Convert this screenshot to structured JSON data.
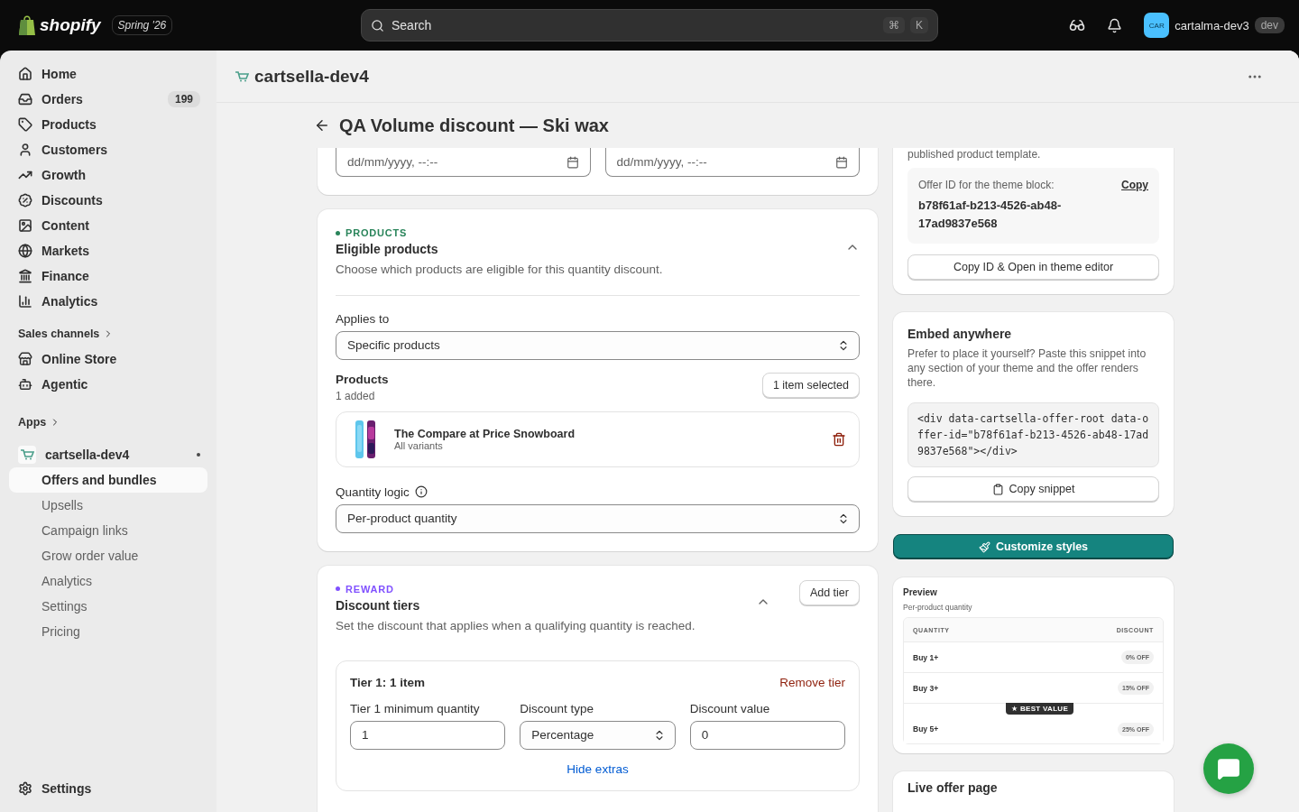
{
  "topbar": {
    "logo": "shopify",
    "edition": "Spring '26",
    "search": {
      "placeholder": "Search",
      "keys": [
        "⌘",
        "K"
      ]
    },
    "avatar": "CAR",
    "store": "cartalma-dev3",
    "tag": "dev"
  },
  "sidebar": {
    "items": [
      {
        "label": "Home",
        "selected": false
      },
      {
        "label": "Orders",
        "badge": "199",
        "selected": false
      },
      {
        "label": "Products",
        "selected": false
      },
      {
        "label": "Customers",
        "selected": false
      },
      {
        "label": "Growth",
        "selected": false
      },
      {
        "label": "Discounts",
        "selected": false
      },
      {
        "label": "Content",
        "selected": false
      },
      {
        "label": "Markets",
        "selected": false
      },
      {
        "label": "Finance",
        "selected": false
      },
      {
        "label": "Analytics",
        "selected": false
      }
    ],
    "sales_channels": {
      "title": "Sales channels",
      "items": [
        {
          "label": "Online Store",
          "selected": false
        },
        {
          "label": "Agentic",
          "selected": false
        }
      ]
    },
    "apps": {
      "title": "Apps",
      "app": {
        "label": "cartsella-dev4",
        "children": [
          {
            "label": "Offers and bundles",
            "selected": true
          },
          {
            "label": "Upsells",
            "selected": false
          },
          {
            "label": "Campaign links",
            "selected": false
          },
          {
            "label": "Grow order value",
            "selected": false
          },
          {
            "label": "Analytics",
            "selected": false
          },
          {
            "label": "Settings",
            "selected": false
          },
          {
            "label": "Pricing",
            "selected": false
          }
        ]
      }
    },
    "settings": "Settings"
  },
  "app_header": {
    "title": "cartsella-dev4"
  },
  "page": {
    "title": "QA Volume discount — Ski wax",
    "dates": [
      {
        "placeholder": "dd/mm/yyyy, --:--"
      },
      {
        "placeholder": "dd/mm/yyyy, --:--"
      }
    ],
    "products": {
      "eyebrow": "PRODUCTS",
      "color": "#29845a",
      "title": "Eligible products",
      "description": "Choose which products are eligible for this quantity discount.",
      "expanded": true,
      "applies_label": "Applies to",
      "applies_value": "Specific products",
      "products_label": "Products",
      "products_count": "1 added",
      "selected_button": "1 item selected",
      "items": [
        {
          "name": "The Compare at Price Snowboard",
          "variants": "All variants"
        }
      ],
      "logic_label": "Quantity logic",
      "logic_value": "Per-product quantity"
    },
    "reward": {
      "eyebrow": "REWARD",
      "color": "#8051ff",
      "title": "Discount tiers",
      "description": "Set the discount that applies when a qualifying quantity is reached.",
      "expanded": true,
      "add_button": "Add tier",
      "tiers": [
        {
          "title": "Tier 1: 1 item",
          "remove": "Remove tier",
          "min_label": "Tier 1 minimum quantity",
          "min_value": "1",
          "type_label": "Discount type",
          "type_value": "Percentage",
          "value_label": "Discount value",
          "value": "0",
          "extras_link": "Hide extras"
        }
      ]
    }
  },
  "side": {
    "theme": {
      "text": "published product template.",
      "id_label": "Offer ID for the theme block:",
      "copy_link": "Copy",
      "id": "b78f61af-b213-4526-ab48-17ad9837e568",
      "button": "Copy ID & Open in theme editor"
    },
    "embed": {
      "title": "Embed anywhere",
      "description": "Prefer to place it yourself? Paste this snippet into any section of your theme and the offer renders there.",
      "code": "<div data-cartsella-offer-root data-offer-id=\"b78f61af-b213-4526-ab48-17ad9837e568\"></div>",
      "button": "Copy snippet"
    },
    "customize_button": "Customize styles",
    "preview": {
      "title": "Preview",
      "subtitle": "Per-product quantity",
      "columns": [
        "QUANTITY",
        "DISCOUNT"
      ],
      "rows": [
        {
          "quantity": "Buy 1+",
          "discount": "0% OFF",
          "best": false
        },
        {
          "quantity": "Buy 3+",
          "discount": "15% OFF",
          "best": false
        },
        {
          "quantity": "Buy 5+",
          "discount": "25% OFF",
          "best": true
        }
      ],
      "best_label": "★ BEST VALUE"
    },
    "live": {
      "title": "Live offer page"
    }
  }
}
